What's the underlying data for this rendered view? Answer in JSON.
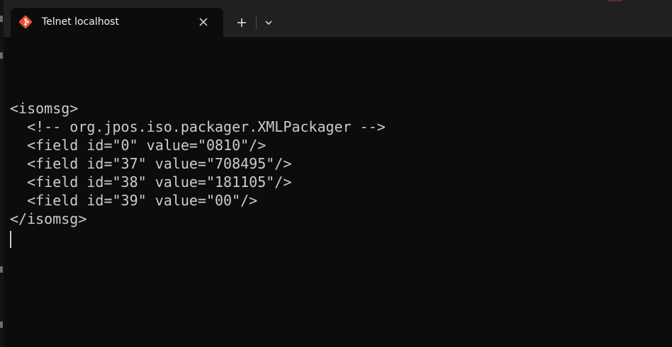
{
  "tab": {
    "title": "Telnet localhost",
    "icon": "git-bash-icon",
    "icon_colors": [
      "#e94d2f",
      "#ffffff"
    ]
  },
  "toolbar": {
    "new_tab_icon": "plus-icon",
    "dropdown_icon": "chevron-down-icon",
    "close_icon": "close-icon"
  },
  "terminal": {
    "lines": [
      "",
      "<isomsg>",
      "  <!-- org.jpos.iso.packager.XMLPackager -->",
      "  <field id=\"0\" value=\"0810\"/>",
      "  <field id=\"37\" value=\"708495\"/>",
      "  <field id=\"38\" value=\"181105\"/>",
      "  <field id=\"39\" value=\"00\"/>",
      "</isomsg>"
    ],
    "foreground": "#cccccc",
    "background": "#0c0c0c"
  }
}
